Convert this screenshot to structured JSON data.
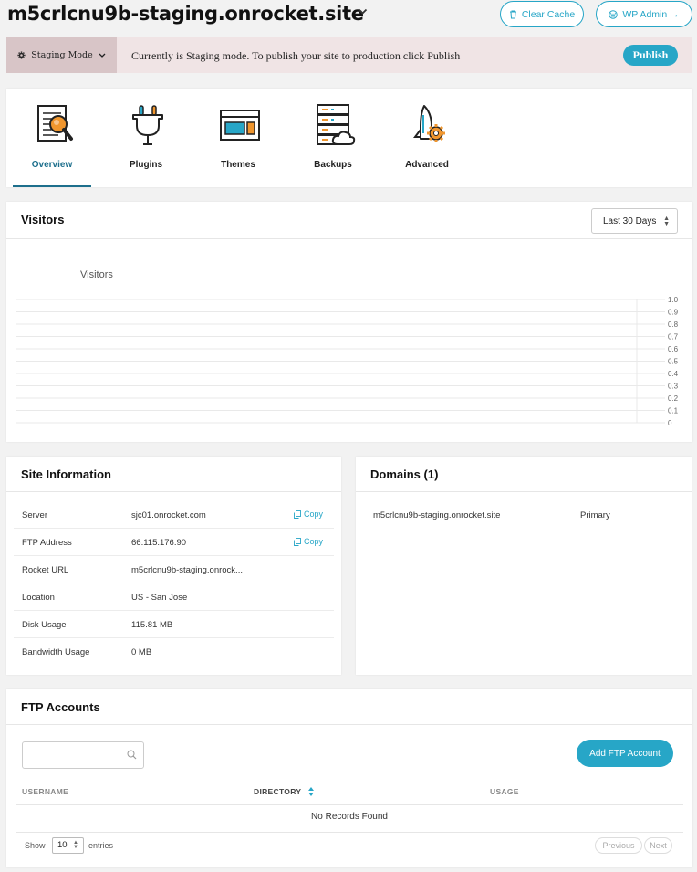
{
  "header": {
    "site_title": "m5crlcnu9b-staging.onrocket.site",
    "clear_cache_label": "Clear Cache",
    "wp_admin_label": "WP Admin →"
  },
  "staging": {
    "mode_label": "Staging Mode",
    "message": "Currently is Staging mode. To publish your site to production click Publish",
    "publish_label": "Publish"
  },
  "tabs": [
    {
      "label": "Overview",
      "icon": "document-search-icon",
      "active": true
    },
    {
      "label": "Plugins",
      "icon": "plug-icon",
      "active": false
    },
    {
      "label": "Themes",
      "icon": "browser-window-icon",
      "active": false
    },
    {
      "label": "Backups",
      "icon": "server-cloud-icon",
      "active": false
    },
    {
      "label": "Advanced",
      "icon": "rocket-gear-icon",
      "active": false
    }
  ],
  "visitors": {
    "title": "Visitors",
    "range_selected": "Last 30 Days",
    "chart_label": "Visitors"
  },
  "chart_data": {
    "type": "line",
    "title": "Visitors",
    "x": [],
    "series": [
      {
        "name": "Visitors",
        "values": []
      }
    ],
    "ylim": [
      0,
      1.0
    ],
    "yticks": [
      "1.0",
      "0.9",
      "0.8",
      "0.7",
      "0.6",
      "0.5",
      "0.4",
      "0.3",
      "0.2",
      "0.1",
      "0"
    ],
    "grid": true
  },
  "site_info": {
    "title": "Site Information",
    "copy_label": "Copy",
    "rows": [
      {
        "label": "Server",
        "value": "sjc01.onrocket.com",
        "copy": true
      },
      {
        "label": "FTP Address",
        "value": "66.115.176.90",
        "copy": true
      },
      {
        "label": "Rocket URL",
        "value": "m5crlcnu9b-staging.onrock...",
        "copy": false
      },
      {
        "label": "Location",
        "value": "US - San Jose",
        "copy": false
      },
      {
        "label": "Disk Usage",
        "value": "115.81 MB",
        "copy": false
      },
      {
        "label": "Bandwidth Usage",
        "value": "0 MB",
        "copy": false
      }
    ]
  },
  "domains": {
    "title": "Domains (1)",
    "items": [
      {
        "name": "m5crlcnu9b-staging.onrocket.site",
        "type": "Primary"
      }
    ]
  },
  "ftp": {
    "title": "FTP Accounts",
    "search_placeholder": "",
    "add_label": "Add FTP Account",
    "columns": [
      "USERNAME",
      "DIRECTORY",
      "USAGE"
    ],
    "empty_text": "No Records Found",
    "show_label": "Show",
    "entries_value": "10",
    "entries_label": "entries",
    "prev_label": "Previous",
    "next_label": "Next"
  },
  "colors": {
    "accent": "#27a6c7",
    "active_tab": "#1d6f8c",
    "staging_bg": "#f0e4e5",
    "staging_mode_bg": "#d8c5c7",
    "icon_orange": "#f0962e"
  }
}
